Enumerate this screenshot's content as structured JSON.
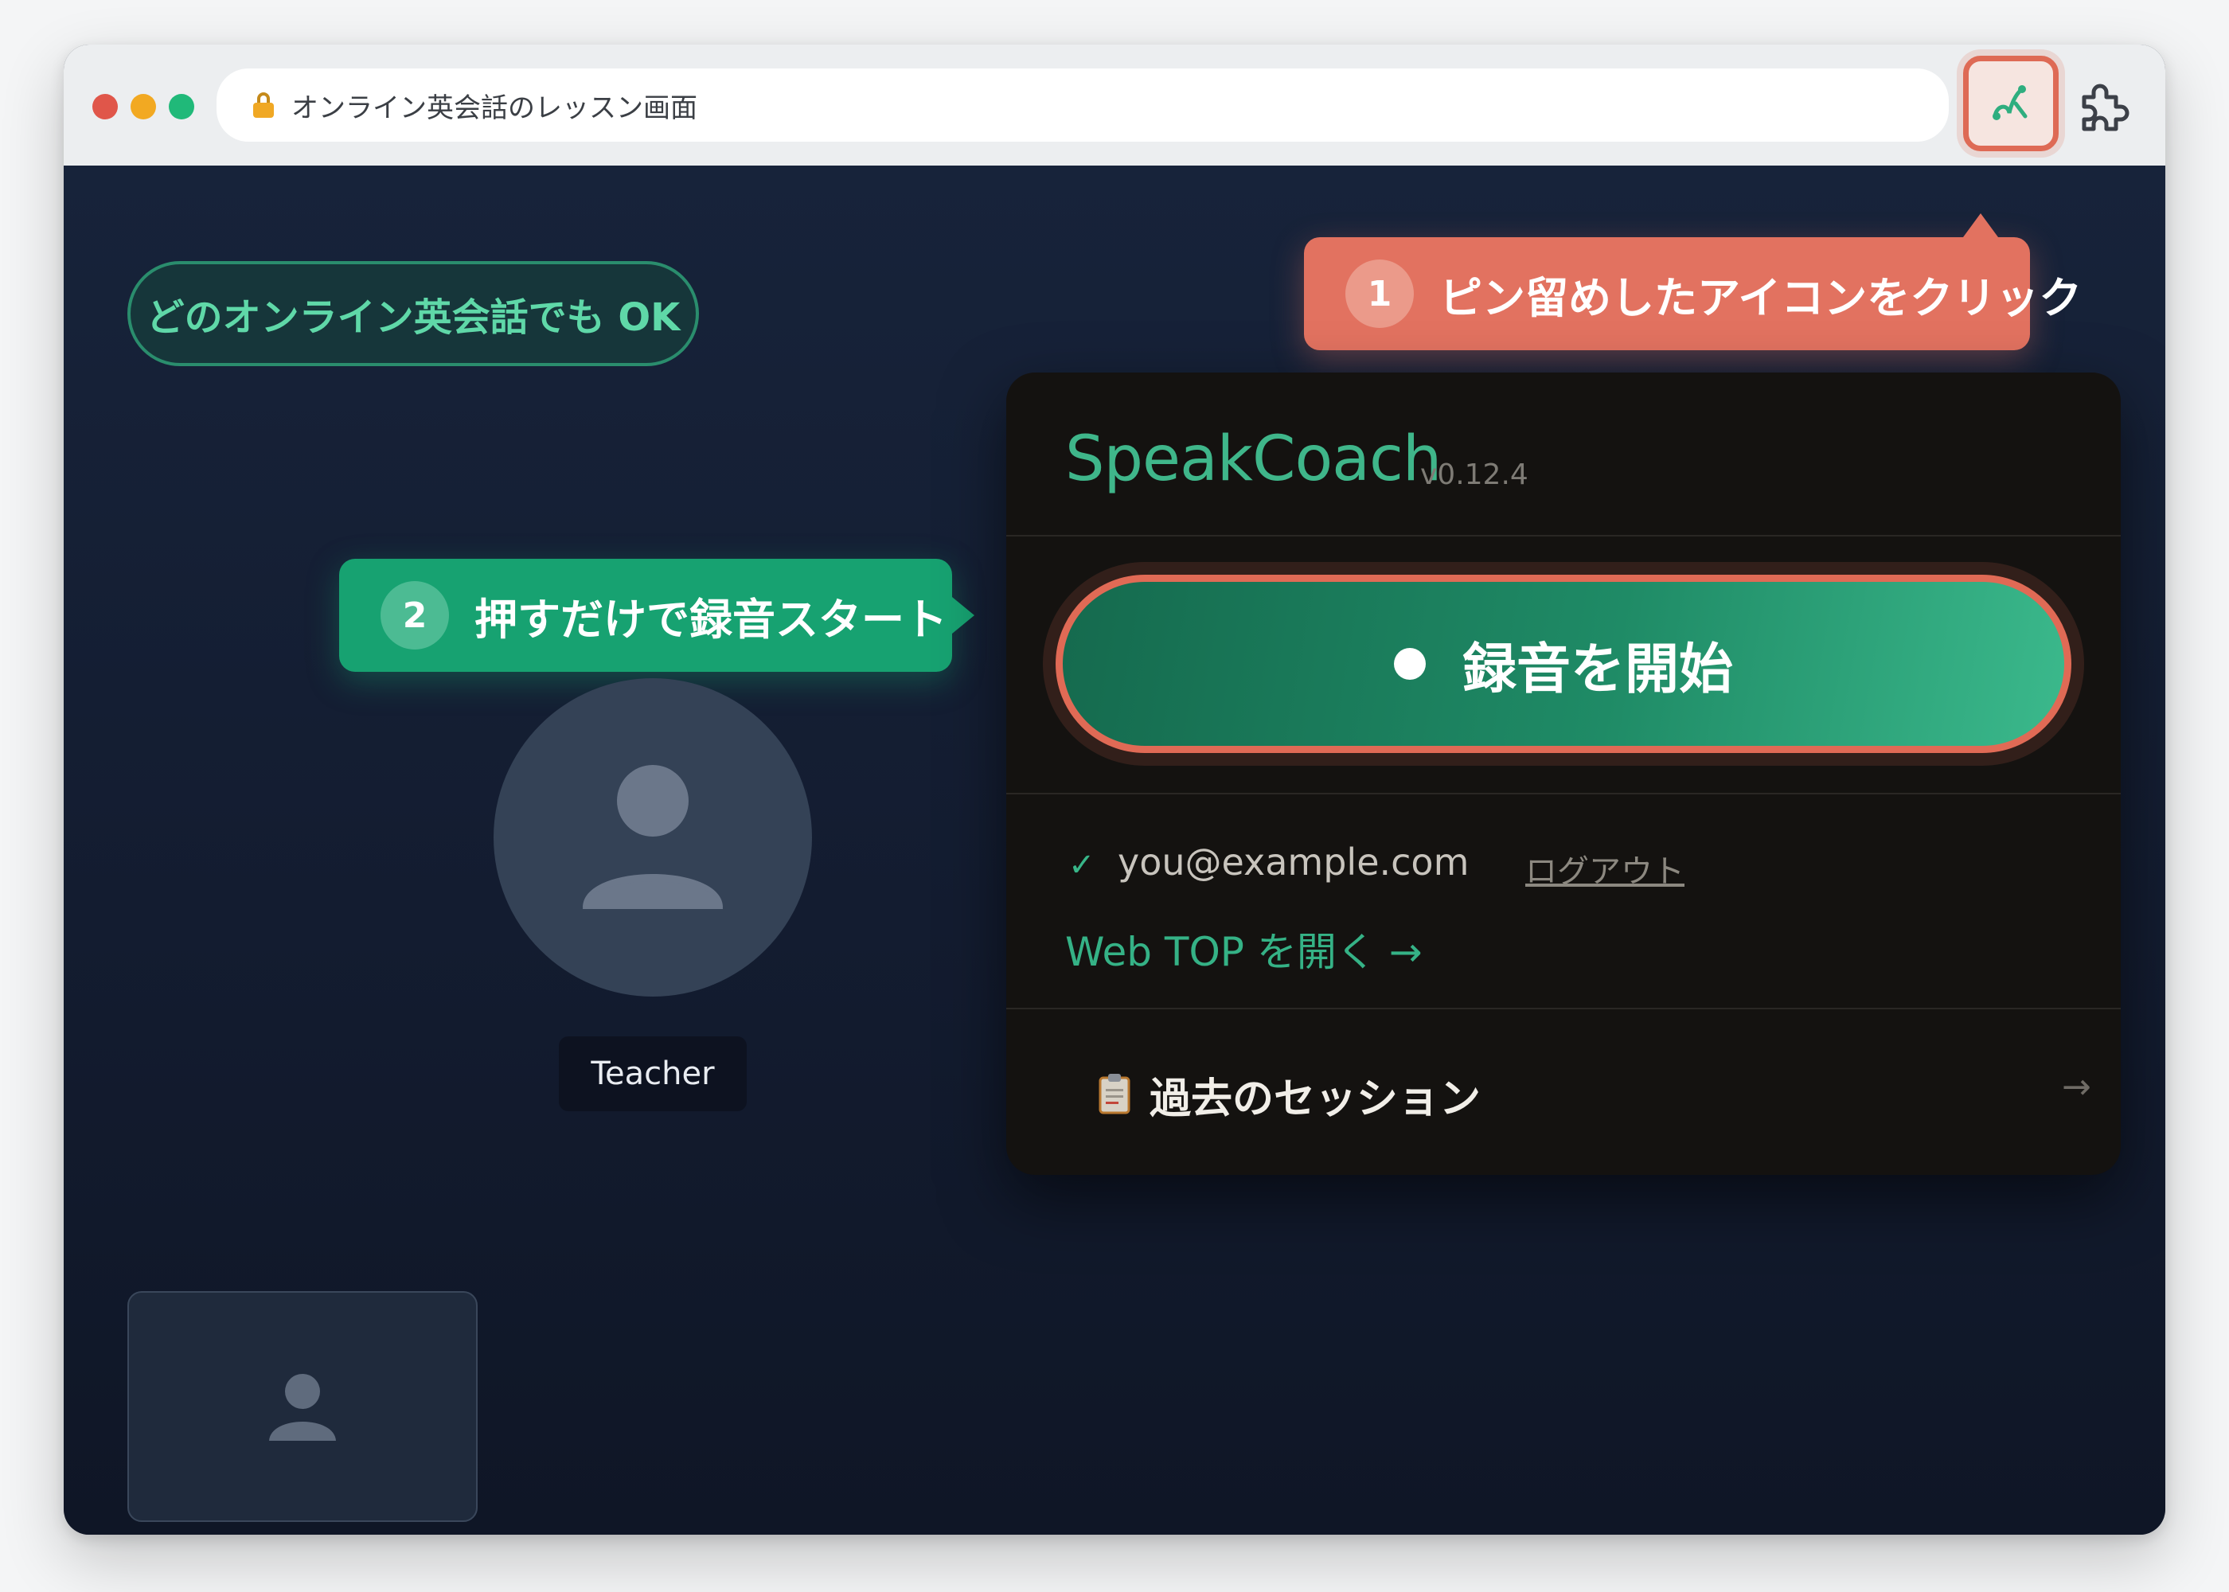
{
  "browser": {
    "address_text": "オンライン英会話のレッスン画面",
    "extension_icon": "speakcoach-extension-icon",
    "puzzle_icon": "extensions-puzzle-icon"
  },
  "stage": {
    "compat_pill": "どのオンライン英会話でも OK",
    "callouts": [
      {
        "number": "1",
        "text": "ピン留めしたアイコンをクリック",
        "color": "#e27260"
      },
      {
        "number": "2",
        "text": "押すだけで録音スタート",
        "color": "#17a271"
      }
    ],
    "teacher_label": "Teacher"
  },
  "popup": {
    "brand": "SpeakCoach",
    "version": "v0.12.4",
    "record_button": "録音を開始",
    "check_mark": "✓",
    "email": "you@example.com",
    "logout": "ログアウト",
    "webtop_link": "Web TOP を開く →",
    "sessions_label": "過去のセッション",
    "sessions_arrow": "→"
  },
  "colors": {
    "accent_green": "#3fb68a",
    "highlight_coral": "#e06a55",
    "stage_bg": "#131c30",
    "popup_bg": "#141210"
  }
}
